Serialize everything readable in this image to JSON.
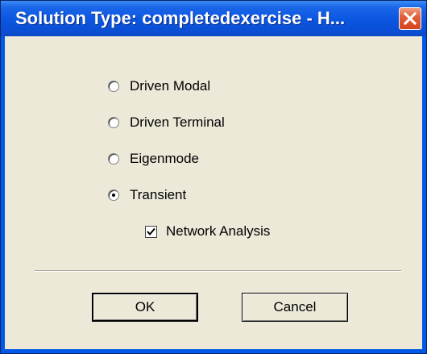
{
  "window": {
    "title": "Solution Type: completedexercise - H..."
  },
  "solution_types": [
    {
      "label": "Driven Modal",
      "selected": false
    },
    {
      "label": "Driven Terminal",
      "selected": false
    },
    {
      "label": "Eigenmode",
      "selected": false
    },
    {
      "label": "Transient",
      "selected": true
    }
  ],
  "options": {
    "network_analysis": {
      "label": "Network Analysis",
      "checked": true
    }
  },
  "buttons": {
    "ok_label": "OK",
    "cancel_label": "Cancel"
  },
  "colors": {
    "titlebar": "#0b55e0",
    "dialog_bg": "#ece9d8",
    "close_button": "#d4431a"
  },
  "icons": {
    "close": "close-icon",
    "check": "checkmark-icon"
  }
}
